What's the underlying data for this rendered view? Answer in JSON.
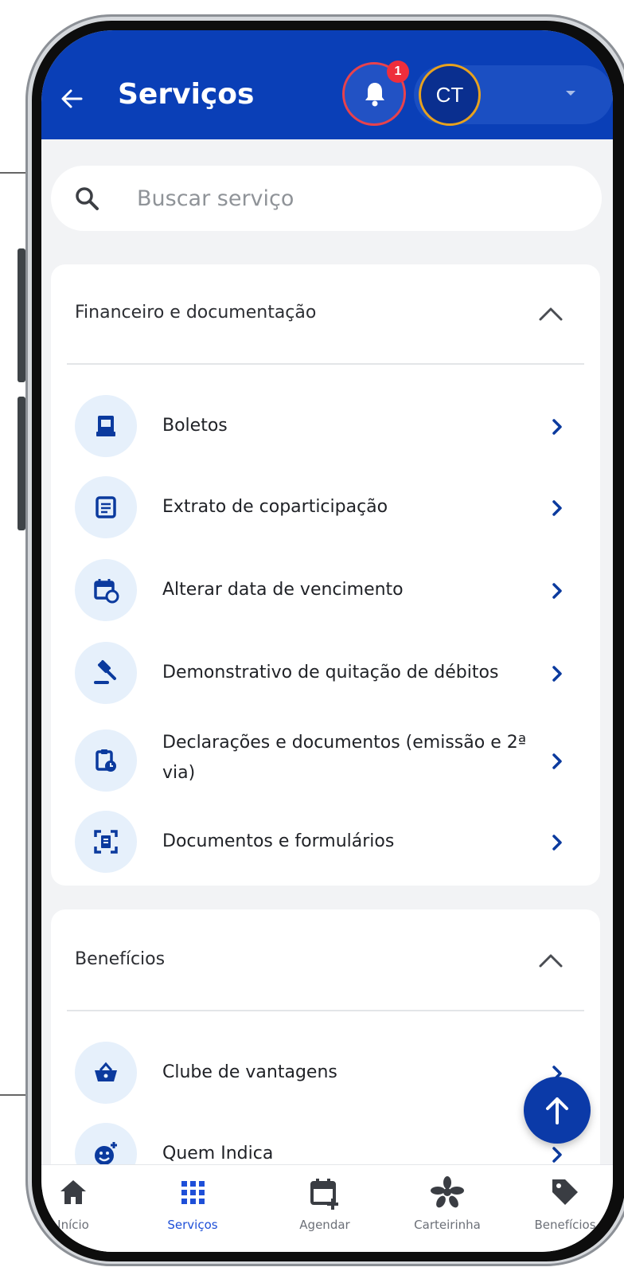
{
  "header": {
    "back_icon": "arrow-left-icon",
    "title": "Serviços",
    "notification_count": "1",
    "avatar_initials": "CT",
    "colors": {
      "header_bg": "#0a3fb7",
      "badge": "#ee2e3c"
    }
  },
  "search": {
    "placeholder": "Buscar serviço",
    "value": ""
  },
  "sections": [
    {
      "title": "Financeiro e documentação",
      "expanded": true,
      "items": [
        {
          "label": "Boletos",
          "icon": "invoice-icon"
        },
        {
          "label": "Extrato de coparticipação",
          "icon": "statement-icon"
        },
        {
          "label": "Alterar data de vencimento",
          "icon": "calendar-refresh-icon"
        },
        {
          "label": "Demonstrativo de quitação de débitos",
          "icon": "gavel-icon"
        },
        {
          "label": "Declarações e documentos (emissão e 2ª via)",
          "icon": "clipboard-clock-icon"
        },
        {
          "label": "Documentos e formulários",
          "icon": "document-scan-icon"
        }
      ]
    },
    {
      "title": "Benefícios",
      "expanded": true,
      "items": [
        {
          "label": "Clube de vantagens",
          "icon": "basket-icon"
        },
        {
          "label": "Quem Indica",
          "icon": "smile-plus-icon"
        }
      ]
    }
  ],
  "bottom_nav": [
    {
      "label": "Início",
      "icon": "home-icon",
      "active": false
    },
    {
      "label": "Serviços",
      "icon": "grid-icon",
      "active": true
    },
    {
      "label": "Agendar",
      "icon": "calendar-plus-icon",
      "active": false
    },
    {
      "label": "Carteirinha",
      "icon": "flower-icon",
      "active": false
    },
    {
      "label": "Benefícios",
      "icon": "tag-icon",
      "active": false
    }
  ]
}
